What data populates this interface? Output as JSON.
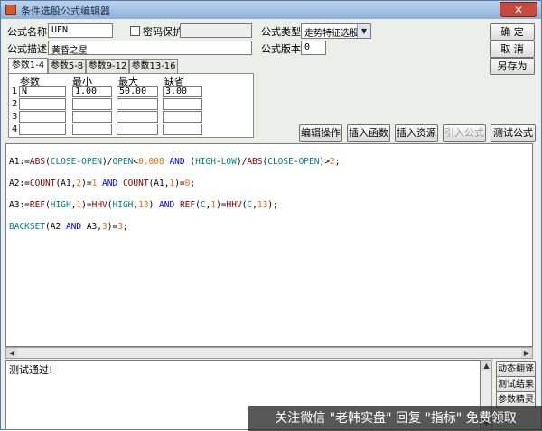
{
  "window": {
    "title": "条件选股公式编辑器",
    "close_glyph": "✕"
  },
  "form": {
    "name_label": "公式名称",
    "name_value": "UFN",
    "password_label": "密码保护",
    "type_label": "公式类型",
    "type_value": "走势特征选股",
    "desc_label": "公式描述",
    "desc_value": "黄昏之星",
    "version_label": "公式版本",
    "version_value": "0"
  },
  "right_buttons": {
    "ok": "确  定",
    "cancel": "取  消",
    "save_as": "另存为"
  },
  "tabs": [
    "参数1-4",
    "参数5-8",
    "参数9-12",
    "参数13-16"
  ],
  "params": {
    "headers": [
      "参数",
      "最小",
      "最大",
      "缺省"
    ],
    "rows": [
      {
        "num": "1",
        "name": "N",
        "min": "1.00",
        "max": "50.00",
        "def": "3.00"
      },
      {
        "num": "2",
        "name": "",
        "min": "",
        "max": "",
        "def": ""
      },
      {
        "num": "3",
        "name": "",
        "min": "",
        "max": "",
        "def": ""
      },
      {
        "num": "4",
        "name": "",
        "min": "",
        "max": "",
        "def": ""
      }
    ]
  },
  "toolbar": {
    "edit": "编辑操作",
    "insert_func": "插入函数",
    "insert_res": "插入资源",
    "import": "引入公式",
    "test": "测试公式"
  },
  "code_lines": [
    "A1:=ABS(CLOSE-OPEN)/OPEN<0.008 AND (HIGH-LOW)/ABS(CLOSE-OPEN)>2;",
    "A2:=COUNT(A1,2)=1 AND COUNT(A1,1)=0;",
    "A3:=REF(HIGH,1)=HHV(HIGH,13) AND REF(C,1)=HHV(C,13);",
    "BACKSET(A2 AND A3,3)=3;"
  ],
  "output": {
    "text": "测试通过!"
  },
  "side_buttons": {
    "dynamic": "动态翻译",
    "result": "测试结果",
    "wizard": "参数精灵"
  },
  "watermark": "关注微信 \"老韩实盘\" 回复 \"指标\" 免费领取",
  "colors": {
    "keyword": "#0000ff",
    "number": "#ff6600",
    "function": "#800000",
    "constant": "#008080"
  }
}
